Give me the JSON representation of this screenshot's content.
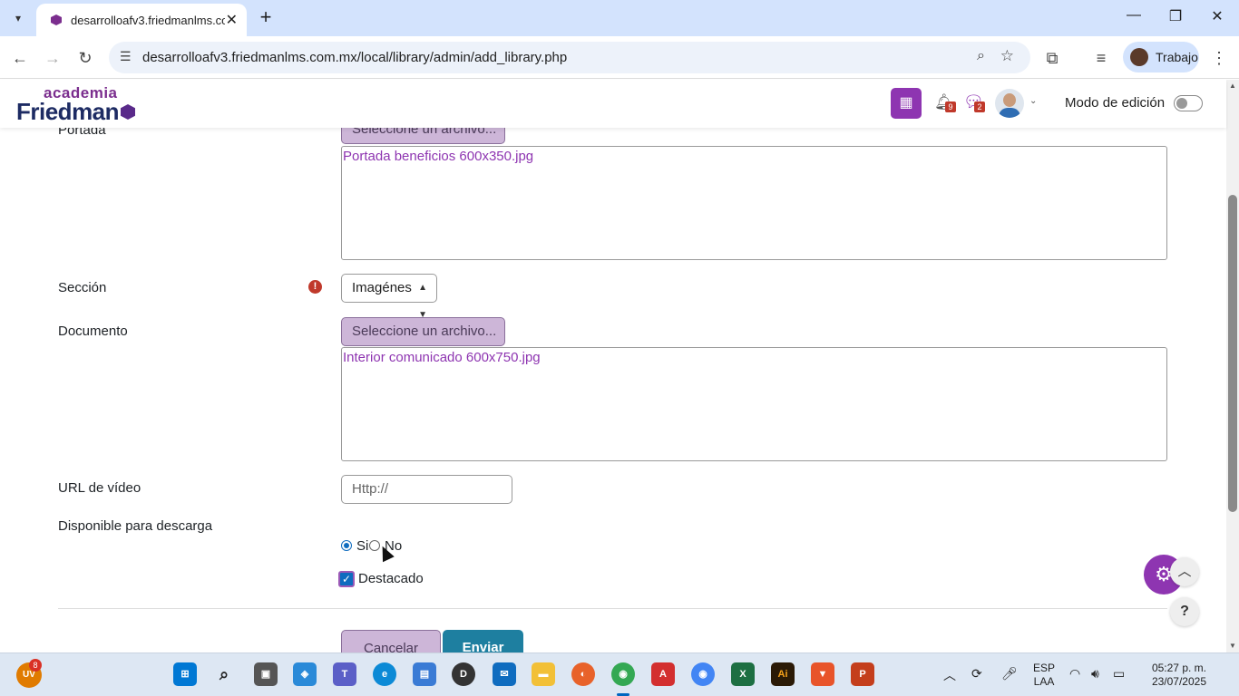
{
  "browser": {
    "tab_title": "desarrolloafv3.friedmanlms.com",
    "url": "desarrolloafv3.friedmanlms.com.mx/local/library/admin/add_library.php",
    "profile_name": "Trabajo"
  },
  "header": {
    "logo_small": "academia",
    "logo_big": "Friedman",
    "notif_count": "9",
    "msg_count": "2",
    "edit_mode_label": "Modo de edición"
  },
  "form": {
    "portada_label": "Portada",
    "portada_button": "Seleccione un archivo...",
    "portada_file": "Portada beneficios 600x350.jpg",
    "seccion_label": "Sección",
    "seccion_value": "Imagénes",
    "documento_label": "Documento",
    "documento_button": "Seleccione un archivo...",
    "documento_file": "Interior comunicado 600x750.jpg",
    "video_label": "URL de vídeo",
    "video_placeholder": "Http://",
    "descarga_label": "Disponible para descarga",
    "radio_si": "Si",
    "radio_no": "No",
    "destacado_label": "Destacado",
    "cancel_label": "Cancelar",
    "submit_label": "Enviar"
  },
  "taskbar": {
    "uv_badge": "8",
    "lang_line1": "ESP",
    "lang_line2": "LAA",
    "time": "05:27 p. m.",
    "date": "23/07/2025"
  }
}
